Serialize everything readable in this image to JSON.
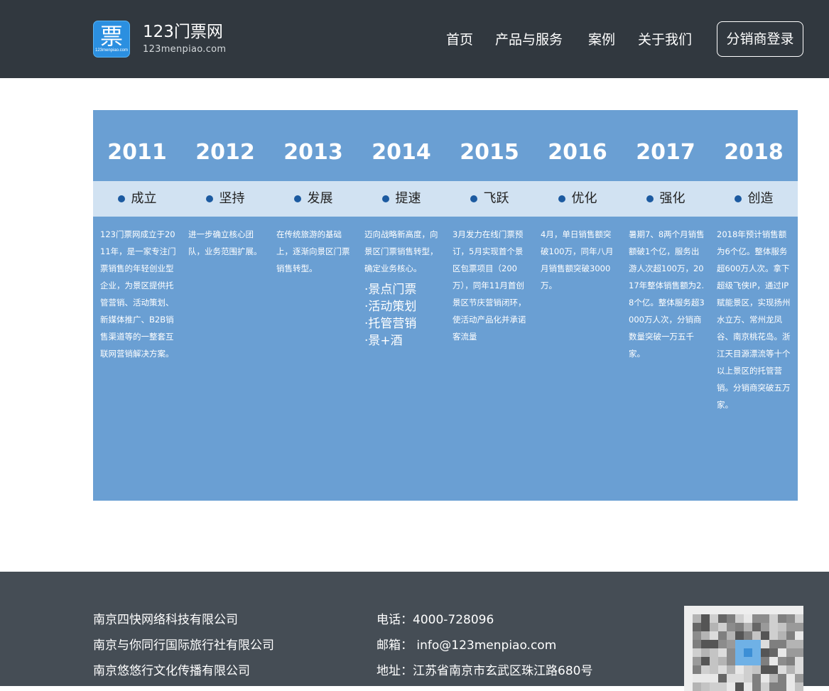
{
  "header": {
    "logo_glyph": "票",
    "logo_tiny": "123menpiao.com",
    "site_name": "123门票网",
    "site_domain": "123menpiao.com",
    "nav": [
      "首页",
      "产品与服务",
      "案例",
      "关于我们"
    ],
    "login_label": "分销商登录"
  },
  "timeline": [
    {
      "year": "2011",
      "stage": "成立",
      "desc": "123门票网成立于2011年，是一家专注门票销售的年轻创业型企业，为景区提供托管营销、活动策划、新媒体推广、B2B销售渠道等的一整套互联网营销解决方案。"
    },
    {
      "year": "2012",
      "stage": "坚持",
      "desc": "进一步确立核心团队，业务范围扩展。"
    },
    {
      "year": "2013",
      "stage": "发展",
      "desc": "在传统旅游的基础上，逐渐向景区门票销售转型。"
    },
    {
      "year": "2014",
      "stage": "提速",
      "desc": "迈向战略新高度，向景区门票销售转型，确定业务核心。",
      "items": [
        "·景点门票",
        "·活动策划",
        "·托管营销",
        "·景+酒"
      ]
    },
    {
      "year": "2015",
      "stage": "飞跃",
      "desc": "3月发力在线门票预订，5月实现首个景区包票项目（200万），同年11月首创景区节庆营销闭环，使活动产品化并承诺客流量"
    },
    {
      "year": "2016",
      "stage": "优化",
      "desc": "4月，单日销售额突破100万，同年八月月销售额突破3000万。"
    },
    {
      "year": "2017",
      "stage": "强化",
      "desc": "暑期7、8两个月销售额破1个亿，服务出游人次超100万，2017年整体销售额为2.8个亿。整体服务超3000万人次，分销商数量突破一万五千家。"
    },
    {
      "year": "2018",
      "stage": "创造",
      "desc": "2018年预计销售额为6个亿。整体服务超600万人次。拿下超级飞侠IP，通过IP赋能景区，实现扬州水立方、常州龙凤谷、南京桃花岛。浙江天目源漂流等十个以上景区的托管营销。分销商突破五万家。"
    }
  ],
  "footer": {
    "companies": [
      "南京四快网络科技有限公司",
      "南京与你同行国际旅行社有限公司",
      "南京悠悠行文化传播有限公司"
    ],
    "phone": "电话：4000-728096",
    "email": "邮箱： info@123menpiao.com",
    "address": "地址：江苏省南京市玄武区珠江路680号"
  },
  "colors": {
    "header_bg": "#31383f",
    "timeline_bg": "#6a9fd3",
    "stage_bg": "#d1e2f2",
    "stage_dot": "#1c5aa0",
    "footer_bg": "#454d55",
    "logo_blue": "#2b8fe0"
  }
}
